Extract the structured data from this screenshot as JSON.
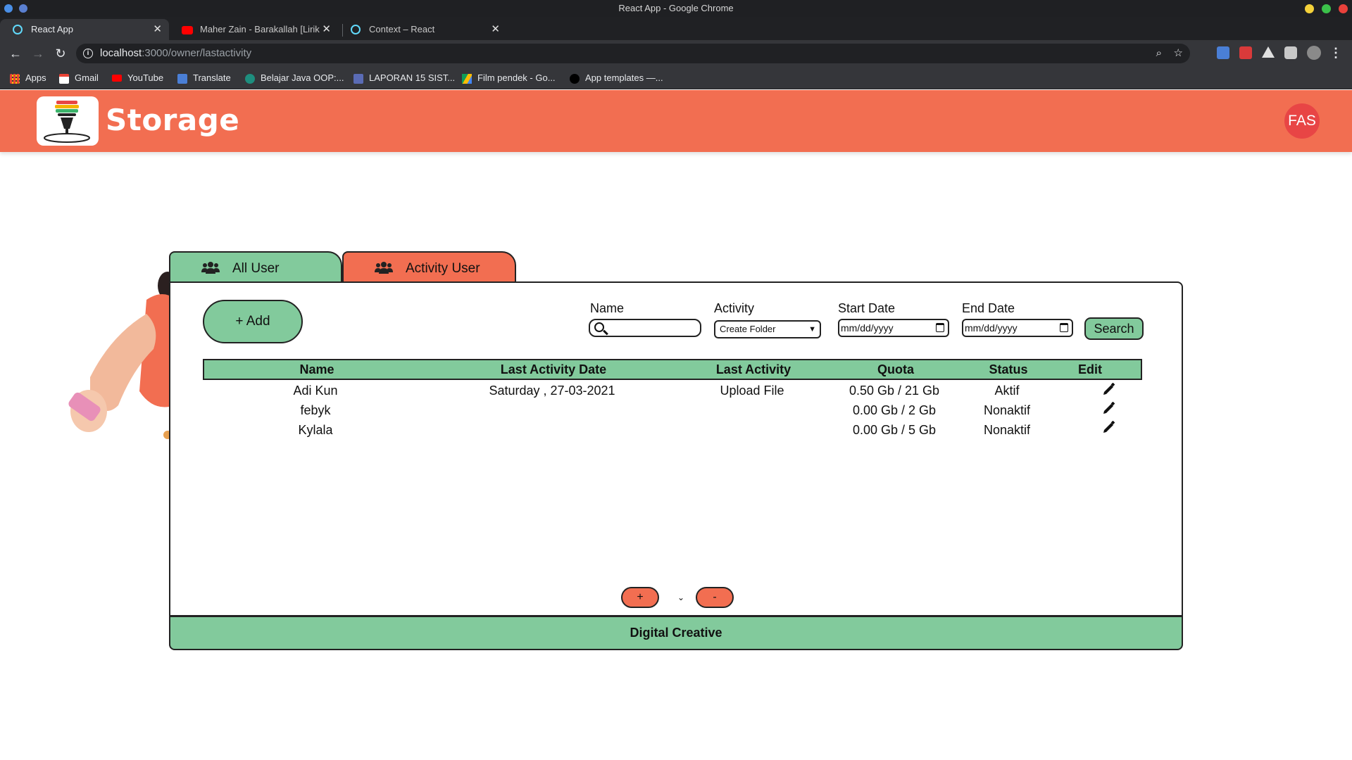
{
  "window": {
    "title": "React App - Google Chrome"
  },
  "browser": {
    "tabs": [
      {
        "label": "React App",
        "active": true
      },
      {
        "label": "Maher Zain - Barakallah [Lirik",
        "active": false
      },
      {
        "label": "Context – React",
        "active": false
      }
    ],
    "url_host": "localhost",
    "url_path": ":3000/owner/lastactivity",
    "bookmarks": [
      {
        "label": "Apps",
        "icon": "apps-grid-icon"
      },
      {
        "label": "Gmail",
        "icon": "gmail-icon"
      },
      {
        "label": "YouTube",
        "icon": "youtube-icon"
      },
      {
        "label": "Translate",
        "icon": "translate-icon"
      },
      {
        "label": "Belajar Java OOP:...",
        "icon": "bookmark-favicon"
      },
      {
        "label": "LAPORAN 15 SIST...",
        "icon": "bookmark-favicon"
      },
      {
        "label": "Film pendek - Go...",
        "icon": "drive-icon"
      },
      {
        "label": "App templates —...",
        "icon": "bookmark-favicon"
      }
    ]
  },
  "app": {
    "title": "Storage",
    "avatar_initials": "FAS",
    "colors": {
      "accent": "#f26e51",
      "green": "#82ca9c",
      "avatar": "#e84545"
    }
  },
  "tabs": {
    "all_user": "All User",
    "activity_user": "Activity User"
  },
  "toolbar": {
    "add_label": "+ Add",
    "name_label": "Name",
    "activity_label": "Activity",
    "activity_value": "Create Folder",
    "start_date_label": "Start Date",
    "start_date_placeholder": "mm/dd/yyyy",
    "end_date_label": "End Date",
    "end_date_placeholder": "mm/dd/yyyy",
    "search_label": "Search"
  },
  "table": {
    "headers": {
      "name": "Name",
      "last_activity_date": "Last Activity Date",
      "last_activity": "Last Activity",
      "quota": "Quota",
      "status": "Status",
      "edit": "Edit"
    },
    "rows": [
      {
        "name": "Adi Kun",
        "last_activity_date": "Saturday , 27-03-2021",
        "last_activity": "Upload File",
        "quota": "0.50 Gb / 21 Gb",
        "status": "Aktif"
      },
      {
        "name": "febyk",
        "last_activity_date": "",
        "last_activity": "",
        "quota": "0.00 Gb / 2 Gb",
        "status": "Nonaktif"
      },
      {
        "name": "Kylala",
        "last_activity_date": "",
        "last_activity": "",
        "quota": "0.00 Gb / 5 Gb",
        "status": "Nonaktif"
      }
    ]
  },
  "pager": {
    "prev_label": "+",
    "next_label": "-"
  },
  "footer": {
    "text": "Digital Creative"
  }
}
